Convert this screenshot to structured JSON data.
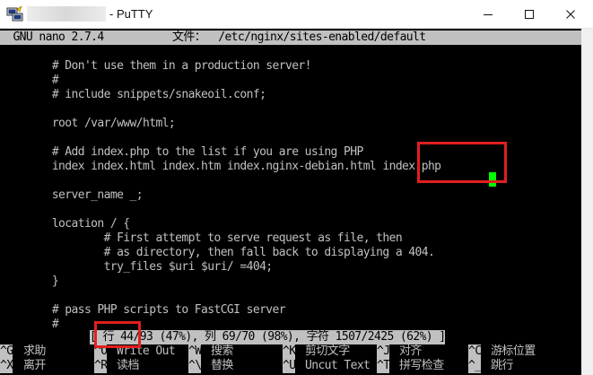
{
  "window": {
    "title": "- PuTTY",
    "controls": [
      "minimize-icon",
      "maximize-icon",
      "close-icon"
    ]
  },
  "nano": {
    "version": "  GNU nano 2.7.4",
    "file_label": "文件：",
    "file_path": " /etc/nginx/sites-enabled/default"
  },
  "editor_lines": [
    "        # Don't use them in a production server!",
    "        #",
    "        # include snippets/snakeoil.conf;",
    "",
    "        root /var/www/html;",
    "",
    "        # Add index.php to the list if you are using PHP",
    "        index index.html index.htm index.nginx-debian.html index.php",
    "",
    "        server_name _;",
    "",
    "        location / {",
    "                # First attempt to serve request as file, then",
    "                # as directory, then fall back to displaying a 404.",
    "                try_files $uri $uri/ =404;",
    "        }",
    "",
    "        # pass PHP scripts to FastCGI server",
    "        #"
  ],
  "status": "[ 行 44/93 (47%), 列 69/70 (98%), 字符 1507/2425 (62%) ]",
  "shortcuts_row1": [
    {
      "key": "^G",
      "label": "求助"
    },
    {
      "key": "^O",
      "label": "Write Out"
    },
    {
      "key": "^W",
      "label": "搜索"
    },
    {
      "key": "^K",
      "label": "剪切文字"
    },
    {
      "key": "^J",
      "label": "对齐"
    },
    {
      "key": "^C",
      "label": "游标位置"
    }
  ],
  "shortcuts_row2": [
    {
      "key": "^X",
      "label": "离开"
    },
    {
      "key": "^R",
      "label": "读档"
    },
    {
      "key": "^\\",
      "label": "替换"
    },
    {
      "key": "^U",
      "label": "Uncut Text"
    },
    {
      "key": "^T",
      "label": "拼写检查"
    },
    {
      "key": "^_",
      "label": "跳行"
    }
  ],
  "colors": {
    "terminal_bg": "#000000",
    "terminal_fg": "#c0c0c0",
    "cursor": "#00ff00",
    "highlight_box": "#e0201f"
  }
}
